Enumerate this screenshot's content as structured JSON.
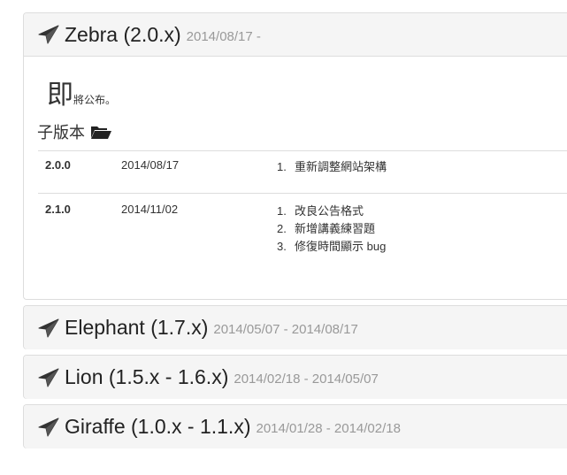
{
  "versions": [
    {
      "name": "Zebra (2.0.x)",
      "dates": "2014/08/17 -"
    },
    {
      "name": "Elephant (1.7.x)",
      "dates": "2014/05/07 - 2014/08/17"
    },
    {
      "name": "Lion (1.5.x - 1.6.x)",
      "dates": "2014/02/18 - 2014/05/07"
    },
    {
      "name": "Giraffe (1.0.x - 1.1.x)",
      "dates": "2014/01/28 - 2014/02/18"
    }
  ],
  "zebra_body": {
    "intro_big": "即",
    "intro_small": "將公布。",
    "subversions_heading": "子版本",
    "rows": [
      {
        "version": "2.0.0",
        "date": "2014/08/17",
        "changes": [
          "重新調整網站架構"
        ]
      },
      {
        "version": "2.1.0",
        "date": "2014/11/02",
        "changes": [
          "改良公告格式",
          "新增講義練習題",
          "修復時間顯示 bug"
        ]
      }
    ]
  },
  "icons": {
    "version": "paper-plane-icon",
    "folder": "folder-open-icon"
  },
  "colors": {
    "heading_bg": "#f5f5f5",
    "border": "#dddddd",
    "date_text": "#999999"
  }
}
